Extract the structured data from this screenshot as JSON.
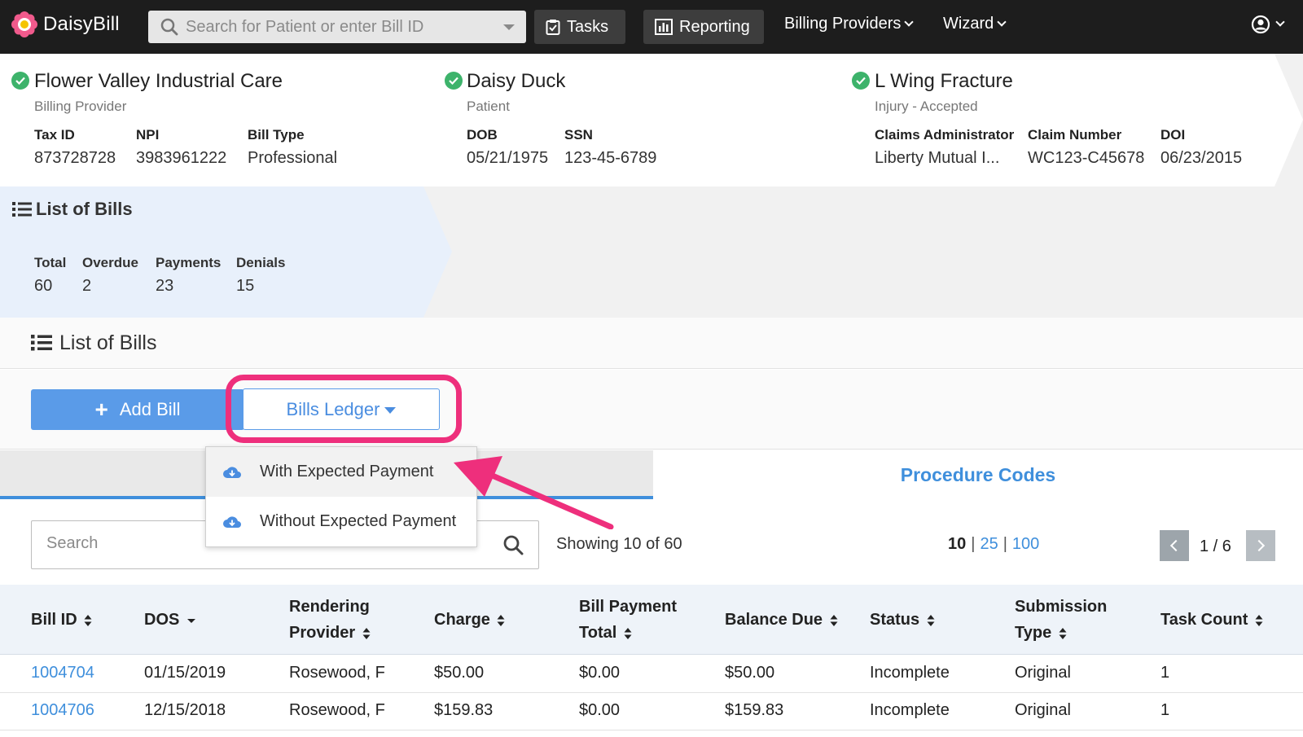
{
  "app": {
    "name": "DaisyBill"
  },
  "topbar": {
    "search_placeholder": "Search for Patient or enter Bill ID",
    "tasks_label": "Tasks",
    "reporting_label": "Reporting",
    "billing_providers_label": "Billing Providers",
    "wizard_label": "Wizard"
  },
  "provider": {
    "name": "Flower Valley Industrial Care",
    "role": "Billing Provider",
    "tax_id_label": "Tax ID",
    "tax_id": "873728728",
    "npi_label": "NPI",
    "npi": "3983961222",
    "bill_type_label": "Bill Type",
    "bill_type": "Professional"
  },
  "patient": {
    "name": "Daisy Duck",
    "role": "Patient",
    "dob_label": "DOB",
    "dob": "05/21/1975",
    "ssn_label": "SSN",
    "ssn": "123-45-6789"
  },
  "injury": {
    "name": "L Wing Fracture",
    "status": "Injury - Accepted",
    "claims_admin_label": "Claims Administrator",
    "claims_admin": "Liberty Mutual I...",
    "claim_number_label": "Claim Number",
    "claim_number": "WC123-C45678",
    "doi_label": "DOI",
    "doi": "06/23/2015"
  },
  "summary": {
    "title": "List of Bills",
    "total_label": "Total",
    "total": "60",
    "overdue_label": "Overdue",
    "overdue": "2",
    "payments_label": "Payments",
    "payments": "23",
    "denials_label": "Denials",
    "denials": "15"
  },
  "section": {
    "title": "List of Bills"
  },
  "toolbar": {
    "add_bill_label": "Add Bill",
    "ledger_label": "Bills Ledger"
  },
  "dropdown": {
    "items": [
      {
        "label": "With Expected Payment"
      },
      {
        "label": "Without Expected Payment"
      }
    ]
  },
  "tabs": {
    "right_label": "Procedure Codes"
  },
  "table_controls": {
    "search_placeholder": "Search",
    "showing": "Showing 10 of 60",
    "page_sizes": [
      "10",
      "25",
      "100"
    ],
    "page_indicator": "1 / 6"
  },
  "table": {
    "columns": [
      {
        "line1": "Bill ID",
        "line2": ""
      },
      {
        "line1": "DOS",
        "line2": ""
      },
      {
        "line1": "Rendering",
        "line2": "Provider"
      },
      {
        "line1": "Charge",
        "line2": ""
      },
      {
        "line1": "Bill Payment",
        "line2": "Total"
      },
      {
        "line1": "Balance Due",
        "line2": ""
      },
      {
        "line1": "Status",
        "line2": ""
      },
      {
        "line1": "Submission",
        "line2": "Type"
      },
      {
        "line1": "Task Count",
        "line2": ""
      }
    ],
    "rows": [
      [
        "1004704",
        "01/15/2019",
        "Rosewood, F",
        "$50.00",
        "$0.00",
        "$50.00",
        "Incomplete",
        "Original",
        "1"
      ],
      [
        "1004706",
        "12/15/2018",
        "Rosewood, F",
        "$159.83",
        "$0.00",
        "$159.83",
        "Incomplete",
        "Original",
        "1"
      ]
    ]
  },
  "colors": {
    "topbar_bg": "#1d1d1d",
    "accent_blue": "#3f8fdc",
    "check_green": "#3db36b",
    "annotation_pink": "#ee2f7c",
    "summary_bg": "#e8f0fb"
  }
}
